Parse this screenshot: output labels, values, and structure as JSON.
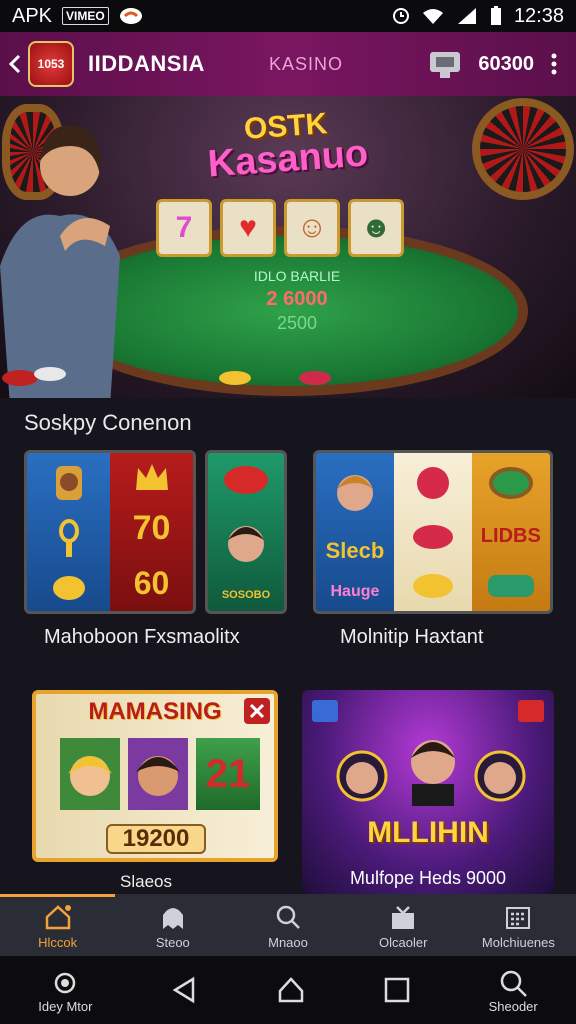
{
  "statusbar": {
    "carrier": "APK",
    "badge": "VIMEO",
    "time": "12:38"
  },
  "appbar": {
    "logo_text": "1053",
    "name": "IIDDANSIA",
    "section": "KASINO",
    "coins": "60300"
  },
  "hero": {
    "title_line1": "OSTK",
    "title_line2": "Kasanuo",
    "table_line1": "IDLO BARLIE",
    "table_line2": "2 6000",
    "table_line3": "2500",
    "reels": [
      "7",
      "♥",
      "☺",
      "☻"
    ]
  },
  "section": {
    "title": "Soskpy Conenon"
  },
  "cards": [
    {
      "caption": "Mahoboon Fxsmaolitx",
      "label_a": "70",
      "label_b": "60",
      "label_c": "SOSOBO"
    },
    {
      "caption": "Molnitip Haxtant",
      "label_a": "Slecb",
      "label_b": "Hauge",
      "label_c": "LIDBS"
    },
    {
      "caption": "Slaeos",
      "title": "MAMASING",
      "amount": "19200",
      "value": "21"
    },
    {
      "caption": "Mulfope Heds 9000",
      "title": "MLLIHIN"
    }
  ],
  "nav": [
    {
      "label": "Hlccok",
      "icon": "home-icon"
    },
    {
      "label": "Steoo",
      "icon": "ghost-icon"
    },
    {
      "label": "Mnaoo",
      "icon": "search-icon"
    },
    {
      "label": "Olcaoler",
      "icon": "gift-icon"
    },
    {
      "label": "Molchiuenes",
      "icon": "calendar-icon"
    }
  ],
  "sysnav": {
    "left_label": "Idey Mtor",
    "right_label": "Sheoder"
  },
  "colors": {
    "accent": "#f2a23a",
    "appbar": "#7a1660"
  }
}
